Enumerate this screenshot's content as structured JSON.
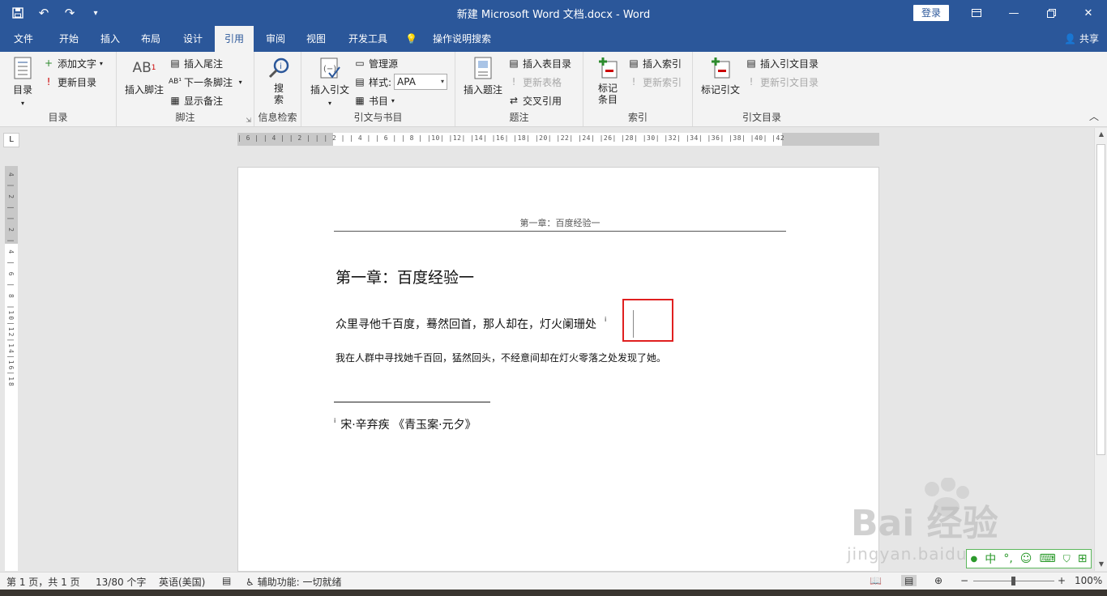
{
  "titlebar": {
    "title": "新建 Microsoft Word 文档.docx  -  Word",
    "login_label": "登录",
    "qat": [
      "save-icon",
      "undo-icon",
      "redo-icon",
      "customize-icon"
    ],
    "window_controls": [
      "ribbon-display-icon",
      "minimize-icon",
      "restore-icon",
      "close-icon"
    ]
  },
  "tabs": {
    "items": [
      "文件",
      "开始",
      "插入",
      "布局",
      "设计",
      "引用",
      "审阅",
      "视图",
      "开发工具"
    ],
    "active": "引用",
    "tell_me": "操作说明搜索",
    "share": "共享"
  },
  "ribbon": {
    "toc": {
      "toc_button": "目录",
      "add_text": "添加文字",
      "update_toc": "更新目录",
      "group_label": "目录"
    },
    "footnotes": {
      "insert_footnote": "插入脚注",
      "insert_endnote": "插入尾注",
      "next_footnote": "下一条脚注",
      "show_notes": "显示备注",
      "group_label": "脚注"
    },
    "research": {
      "search": "搜索",
      "group_label": "信息检索"
    },
    "citations": {
      "insert_citation": "插入引文",
      "manage_sources": "管理源",
      "style_label": "样式:",
      "style_value": "APA",
      "bibliography": "书目",
      "group_label": "引文与书目"
    },
    "captions": {
      "insert_caption": "插入题注",
      "insert_tof": "插入表目录",
      "update_table": "更新表格",
      "cross_ref": "交叉引用",
      "group_label": "题注"
    },
    "index": {
      "mark_entry": "标记条目",
      "insert_index": "插入索引",
      "update_index": "更新索引",
      "group_label": "索引"
    },
    "toa": {
      "mark_citation": "标记引文",
      "insert_toa": "插入引文目录",
      "update_toa": "更新引文目录",
      "group_label": "引文目录"
    }
  },
  "ruler": {
    "horizontal": "| 6 |  | 4 |  | 2 |     |  | 2 |  | 4 |  | 6 |  | 8 |  |10|  |12|  |14|  |16|  |18|  |20|  |22|  |24|  |26|  |28|  |30|  |32|  |34|  |36|  |38|  |40|  |42",
    "vertical": "4 | 2 |  | 2 | 4 | 6 | 8 |10|12|14|16|18",
    "tab_selector": "L"
  },
  "document": {
    "header": "第一章：百度经验一",
    "heading": "第一章：百度经验一",
    "para1": "众里寻他千百度，蓦然回首，那人却在，灯火阑珊处",
    "para1_marker": "i",
    "para2": "我在人群中寻找她千百回，猛然回头，不经意间却在灯火零落之处发现了她。",
    "footnote_marker": "i",
    "footnote": "宋·辛弃疾 《青玉案·元夕》"
  },
  "statusbar": {
    "page": "第 1 页，共 1 页",
    "words": "13/80 个字",
    "language": "英语(美国)",
    "accessibility": "辅助功能: 一切就绪",
    "zoom": "100%",
    "zoom_minus": "−",
    "zoom_plus": "+"
  },
  "watermark": {
    "brand": "Bai 经验",
    "url": "jingyan.baidu.com"
  },
  "ime": [
    "中",
    "°,",
    "☺",
    "⌨",
    "👕",
    "⊞"
  ],
  "colors": {
    "accent": "#2b579a",
    "ribbon_bg": "#f3f3f3",
    "highlight_box": "#e02020"
  }
}
